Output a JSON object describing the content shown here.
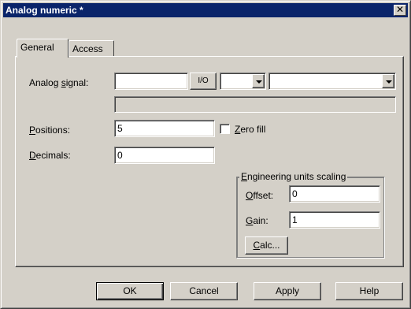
{
  "window": {
    "title": "Analog numeric *",
    "close_glyph": "✕"
  },
  "tabs": [
    {
      "label": "General",
      "active": true
    },
    {
      "label": "Access",
      "active": false
    }
  ],
  "general": {
    "analog_signal": {
      "label_pre": "Analog ",
      "label_ul": "s",
      "label_post": "ignal:",
      "value": "",
      "io_button": "I/O",
      "type_value": "",
      "tag_value": "",
      "description": ""
    },
    "positions": {
      "label_ul": "P",
      "label_post": "ositions:",
      "value": "5"
    },
    "zero_fill": {
      "label_ul": "Z",
      "label_post": "ero fill",
      "checked": false
    },
    "decimals": {
      "label_ul": "D",
      "label_post": "ecimals:",
      "value": "0"
    },
    "scaling": {
      "legend_ul": "E",
      "legend_post": "ngineering units scaling",
      "offset": {
        "label_ul": "O",
        "label_post": "ffset:",
        "value": "0"
      },
      "gain": {
        "label_ul": "G",
        "label_post": "ain:",
        "value": "1"
      },
      "calc_ul": "C",
      "calc_post": "alc..."
    }
  },
  "buttons": {
    "ok": "OK",
    "cancel": "Cancel",
    "apply": "Apply",
    "help": "Help"
  },
  "colors": {
    "titlebar": "#0a246a",
    "face": "#d4d0c8"
  }
}
